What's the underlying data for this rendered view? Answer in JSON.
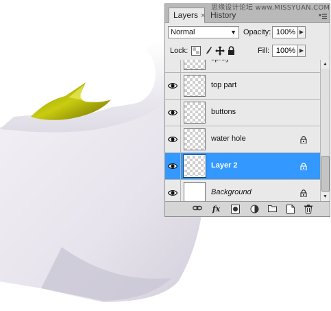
{
  "watermark": "思缘设计论坛 www.MISSYUAN.COM",
  "panel": {
    "tabs": [
      {
        "label": "Layers",
        "close": "×",
        "active": true
      },
      {
        "label": "History",
        "active": false
      }
    ],
    "menu_icon": "panel-menu-icon",
    "blend_mode": "Normal",
    "opacity_label": "Opacity:",
    "opacity_value": "100%",
    "lock_label": "Lock:",
    "fill_label": "Fill:",
    "fill_value": "100%",
    "fx_label": "fx"
  },
  "layers": [
    {
      "name": "spray",
      "visible": false,
      "thumb": "transparent",
      "locked": false,
      "selected": false
    },
    {
      "name": "top part",
      "visible": true,
      "thumb": "transparent",
      "locked": false,
      "selected": false
    },
    {
      "name": "buttons",
      "visible": true,
      "thumb": "transparent",
      "locked": false,
      "selected": false
    },
    {
      "name": "water hole",
      "visible": true,
      "thumb": "transparent",
      "locked": true,
      "selected": false
    },
    {
      "name": "Layer 2",
      "visible": true,
      "thumb": "transparent",
      "locked": true,
      "selected": true
    },
    {
      "name": "Background",
      "visible": true,
      "thumb": "white",
      "locked": true,
      "selected": false
    }
  ],
  "colors": {
    "selection": "#3398ff",
    "panel_bg": "#e9e9e9",
    "accent_yellow": "#b5b800"
  }
}
